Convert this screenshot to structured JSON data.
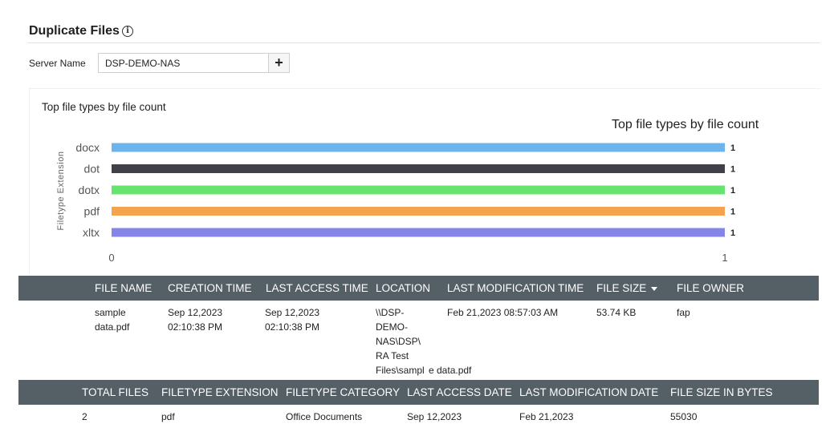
{
  "page": {
    "title": "Duplicate Files",
    "info_icon": "info-icon"
  },
  "filter": {
    "server_label": "Server Name",
    "server_value": "DSP-DEMO-NAS",
    "add_label": "+"
  },
  "chart_panel": {
    "panel_title": "Top file types by file count"
  },
  "chart_data": {
    "type": "bar",
    "orientation": "horizontal",
    "title": "Top file types by file count",
    "ylabel": "Filetype Extension",
    "xlabel": "",
    "categories": [
      "docx",
      "dot",
      "dotx",
      "pdf",
      "xltx"
    ],
    "values": [
      1,
      1,
      1,
      1,
      1
    ],
    "colors": [
      "#6cb4ec",
      "#404048",
      "#67e46f",
      "#f6a34e",
      "#8585e8"
    ],
    "xlim": [
      0,
      1
    ],
    "x_ticks": [
      "0",
      "1"
    ],
    "data_labels": [
      "1",
      "1",
      "1",
      "1",
      "1"
    ],
    "grid": false
  },
  "files_table": {
    "columns": [
      "FILE NAME",
      "CREATION TIME",
      "LAST ACCESS TIME",
      "LOCATION",
      "LAST MODIFICATION TIME",
      "FILE SIZE",
      "FILE OWNER"
    ],
    "sorted_column": "FILE SIZE",
    "rows": [
      {
        "file_name": [
          "sample",
          "data.pdf"
        ],
        "creation_time": [
          "Sep 12,2023",
          "02:10:38 PM"
        ],
        "last_access_time": [
          "Sep 12,2023",
          "02:10:38 PM"
        ],
        "location": [
          "\\\\DSP-",
          "DEMO-",
          "NAS\\DSP\\",
          "RA Test",
          "Files\\sampl"
        ],
        "location_tail": "e data.pdf",
        "last_modification_time": "Feb 21,2023 08:57:03 AM",
        "file_size": "53.74 KB",
        "file_owner": "fap"
      }
    ]
  },
  "summary_table": {
    "columns": [
      "TOTAL FILES",
      "FILETYPE EXTENSION",
      "FILETYPE CATEGORY",
      "LAST ACCESS DATE",
      "LAST MODIFICATION DATE",
      "FILE SIZE IN BYTES"
    ],
    "rows": [
      {
        "total_files": "2",
        "filetype_extension": "pdf",
        "filetype_category": "Office Documents",
        "last_access_date": "Sep 12,2023",
        "last_modification_date": "Feb 21,2023",
        "file_size_in_bytes": "55030"
      }
    ]
  }
}
